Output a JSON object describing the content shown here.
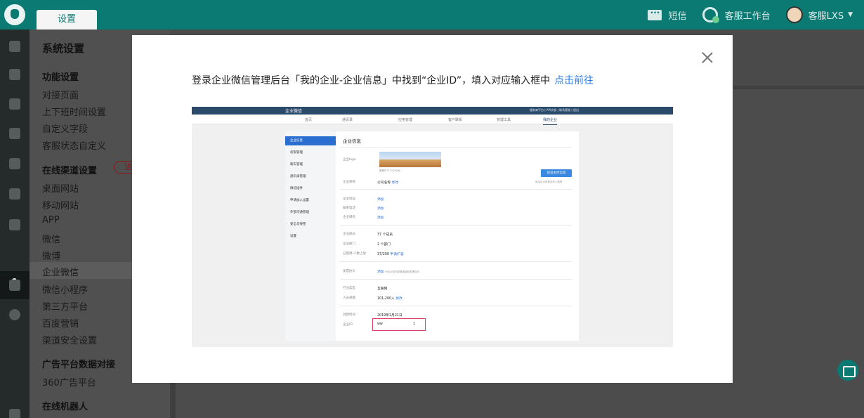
{
  "topbar": {
    "tab_label": "设置",
    "sms_label": "短信",
    "workspace_label": "客服工作台",
    "user_label": "客服LXS",
    "caret": "▼"
  },
  "sidebar": {
    "title": "系统设置",
    "groups": [
      {
        "heading": "功能设置",
        "items": [
          "对接页面",
          "上下班时间设置",
          "自定义字段",
          "客服状态自定义"
        ]
      },
      {
        "heading": "在线渠道设置",
        "items": [
          "桌面网站",
          "移动网站",
          "APP",
          "微信",
          "微博",
          "企业微信",
          "微信小程序",
          "第三方平台",
          "百度营销",
          "渠道安全设置"
        ]
      },
      {
        "heading": "广告平台数据对接",
        "items": [
          "360广告平台"
        ]
      },
      {
        "heading": "在线机器人",
        "items": []
      }
    ],
    "badge": "进",
    "active_item": "企业微信"
  },
  "modal": {
    "instruction": "登录企业微信管理后台「我的企业-企业信息」中找到“企业ID”，填入对应输入框中",
    "link_text": "点击前往"
  },
  "shot": {
    "brand": "企业微信",
    "top_links": "服务商平台  |  API文档  |  联系客服  |  退出",
    "nav": [
      "首页",
      "通讯录",
      "应用管理",
      "客户联系",
      "管理工具",
      "我的企业"
    ],
    "side_items": [
      "企业信息",
      "权限管理",
      "聊天管理",
      "通讯录管理",
      "微信插件",
      "申请加入设置",
      "外部沟通管理",
      "安全与保密",
      "设置"
    ],
    "title": "企业信息",
    "logo_label": "企业logo",
    "logo_hint": "推荐尺寸 702*180",
    "verify_button": "验证主体信息",
    "verify_hint": "验证后可获更多同人数等",
    "rows": [
      {
        "label": "企业简称",
        "value": "公司名称",
        "link": "修改"
      },
      {
        "label": "企业地址",
        "value": "",
        "link": "添加"
      },
      {
        "label": "联系电话",
        "value": "",
        "link": "添加"
      },
      {
        "label": "企业域名",
        "value": "",
        "link": "添加"
      },
      {
        "label": "企业成员",
        "value": "37 个成员",
        "link": ""
      },
      {
        "label": "企业部门",
        "value": "2 个部门",
        "link": ""
      },
      {
        "label": "已使用/人数上限",
        "value": "37/200",
        "link": "申请扩容"
      },
      {
        "label": "发票抬头",
        "value": "",
        "link": "添加",
        "note": "为企业成员配置增值税发票抬头"
      },
      {
        "label": "行业类型",
        "value": "互联网",
        "link": ""
      },
      {
        "label": "人员规模",
        "value": "101-200人",
        "link": "修改"
      },
      {
        "label": "创建时间",
        "value": "2019年1月21日",
        "link": ""
      },
      {
        "label": "企业ID",
        "value": "ww",
        "link": ""
      }
    ],
    "id_suffix": "1"
  }
}
